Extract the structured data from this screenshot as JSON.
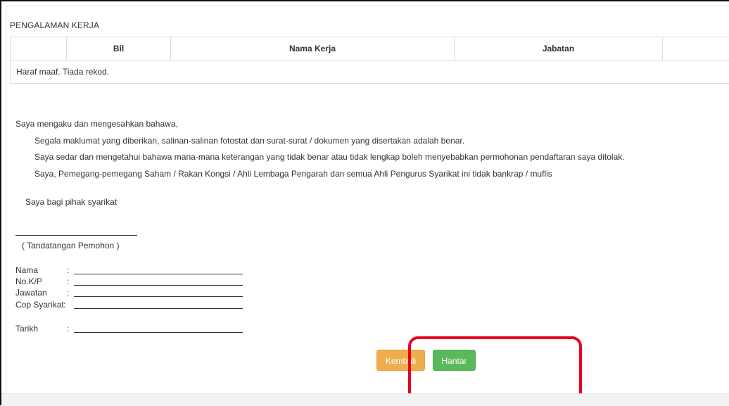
{
  "section": {
    "title": "PENGALAMAN KERJA"
  },
  "table": {
    "columns": [
      "",
      "Bil",
      "Nama Kerja",
      "Jabatan",
      ""
    ],
    "empty_message": "Haraf maaf. Tiada rekod."
  },
  "declaration": {
    "intro": "Saya mengaku dan mengesahkan bahawa,",
    "items": [
      "Segala maklumat yang diberikan, salinan-salinan fotostat dan surat-surat / dokumen yang disertakan adalah benar.",
      "Saya sedar dan mengetahui bahawa mana-mana keterangan yang tidak benar atau tidak lengkap boleh menyebabkan permohonan pendaftaran saya ditolak.",
      "Saya, Pemegang-pemegang Saham / Rakan Kongsi / Ahli Lembaga Pengarah dan semua Ahli Pengurus Syarikat ini tidak bankrap / muflis"
    ],
    "company_line": "Saya bagi pihak syarikat",
    "signature_caption": "( Tandatangan Pemohon )"
  },
  "form_fields": {
    "nama": "Nama",
    "nokp": "No.K/P",
    "jawatan": "Jawatan",
    "cop": "Cop Syarikat",
    "tarikh": "Tarikh",
    "colon": ":"
  },
  "buttons": {
    "back_label": "Kembali",
    "submit_label": "Hantar"
  },
  "colors": {
    "back_button": "#f0ad4e",
    "submit_button": "#5cb85c",
    "highlight": "#e8001c"
  }
}
